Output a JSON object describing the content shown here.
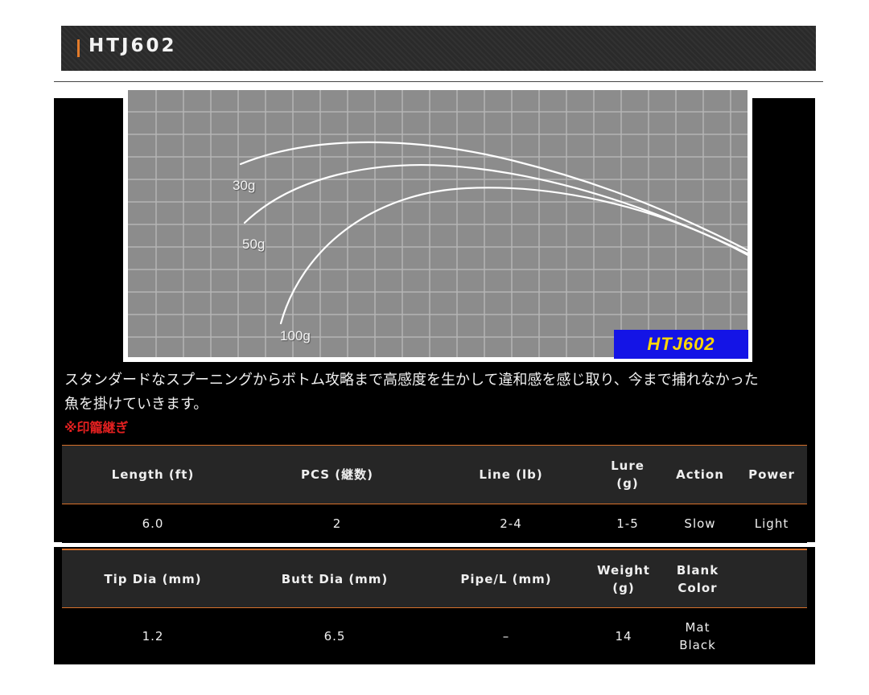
{
  "header": {
    "title": "HTJ602"
  },
  "curve_chart": {
    "badge": "HTJ602",
    "labels": {
      "w30": "30g",
      "w50": "50g",
      "w100": "100g"
    }
  },
  "description": {
    "line1": "スタンダードなスプーニングからボトム攻略まで高感度を生かして違和感を感じ取り、今まで捕れなかった",
    "line2": "魚を掛けていきます。",
    "note": "※印籠継ぎ"
  },
  "spec_table_1": {
    "headers": [
      "Length (ft)",
      "PCS (継数)",
      "Line (lb)",
      "Lure\n(g)",
      "Action",
      "Power"
    ],
    "values": [
      "6.0",
      "2",
      "2-4",
      "1-5",
      "Slow",
      "Light"
    ]
  },
  "spec_table_2": {
    "headers": [
      "Tip Dia (mm)",
      "Butt Dia (mm)",
      "Pipe/L (mm)",
      "Weight\n(g)",
      "Blank\nColor",
      ""
    ],
    "values": [
      "1.2",
      "6.5",
      "–",
      "14",
      "Mat\nBlack",
      ""
    ]
  },
  "colors": {
    "accent": "#e37b2a",
    "badge_bg": "#1414e6",
    "badge_text": "#ffd700",
    "note": "#e32020",
    "grid_bg": "#8c8c8c"
  }
}
